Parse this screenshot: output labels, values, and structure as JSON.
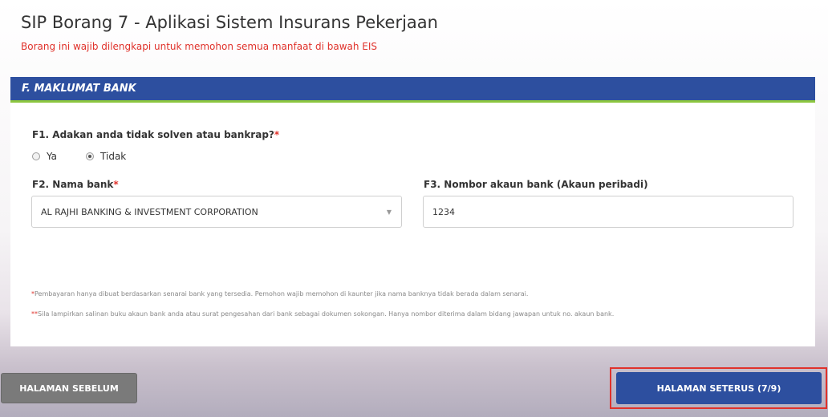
{
  "header": {
    "title": "SIP Borang 7 - Aplikasi Sistem Insurans Pekerjaan",
    "subtitle": "Borang ini wajib dilengkapi untuk memohon semua manfaat di bawah EIS"
  },
  "section": {
    "title": "F. MAKLUMAT BANK",
    "header_color": "#2d4f9f",
    "accent_color": "#8cc63f"
  },
  "f1": {
    "label": "F1. Adakan anda tidak solven atau bankrap?",
    "required_mark": "*",
    "options": [
      {
        "label": "Ya",
        "checked": false
      },
      {
        "label": "Tidak",
        "checked": true
      }
    ]
  },
  "f2": {
    "label": "F2. Nama bank",
    "required_mark": "*",
    "selected": "AL RAJHI BANKING & INVESTMENT CORPORATION",
    "caret": "▼"
  },
  "f3": {
    "label": "F3. Nombor akaun bank (Akaun peribadi)",
    "value": "1234"
  },
  "notes": [
    {
      "star": "*",
      "text": "Pembayaran hanya dibuat berdasarkan senarai bank yang tersedia. Pemohon wajib memohon di kaunter jika nama banknya tidak berada dalam senarai."
    },
    {
      "star": "**",
      "text": "Sila lampirkan salinan buku akaun bank anda atau surat pengesahan dari bank sebagai dokumen sokongan. Hanya nombor diterima dalam bidang jawapan untuk no. akaun bank."
    }
  ],
  "nav": {
    "prev_label": "HALAMAN SEBELUM",
    "next_label": "HALAMAN SETERUS (7/9)"
  }
}
